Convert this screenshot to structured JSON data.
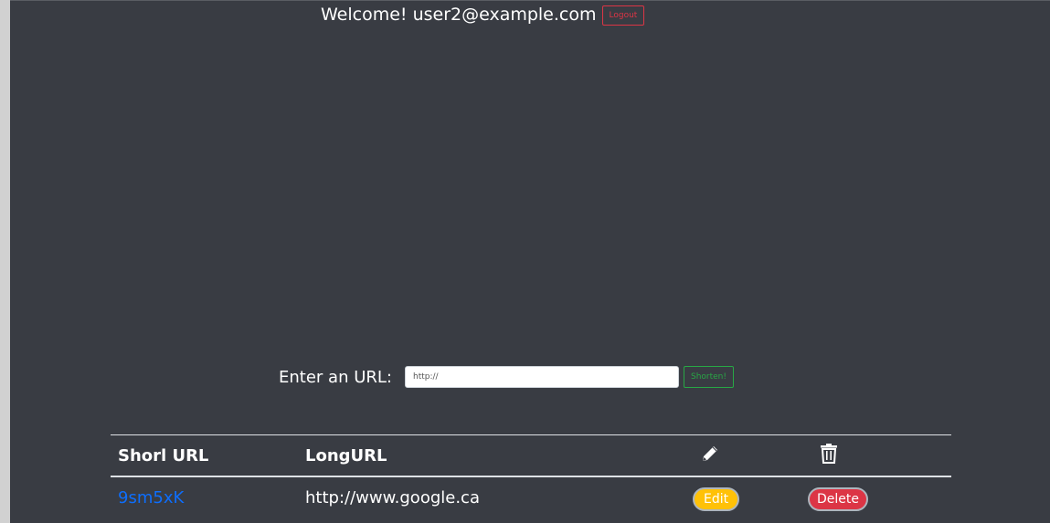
{
  "header": {
    "welcome_text": "Welcome! user2@example.com",
    "logout_label": "Logout"
  },
  "form": {
    "label": "Enter an URL:",
    "input_value": "",
    "input_placeholder": "http://",
    "shorten_label": "Shorten!"
  },
  "table": {
    "columns": {
      "short": "Shorl URL",
      "long": "LongURL",
      "edit_icon": "pencil-icon",
      "delete_icon": "trash-icon"
    },
    "rows": [
      {
        "short_url": "9sm5xK",
        "long_url": "http://www.google.ca",
        "edit_label": "Edit",
        "delete_label": "Delete"
      }
    ]
  },
  "colors": {
    "background": "#393c43",
    "danger": "#dc3545",
    "success": "#28a745",
    "warning": "#ffc107",
    "link": "#0d6efd"
  }
}
